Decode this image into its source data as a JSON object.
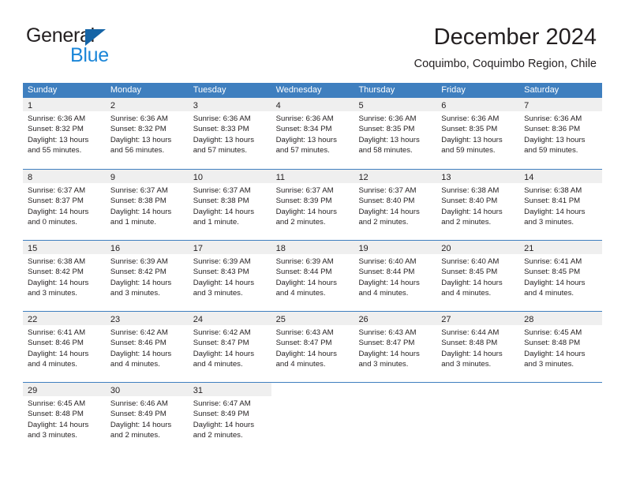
{
  "brand": {
    "word_one": "General",
    "word_two": "Blue",
    "triangle_color": "#1564a6",
    "blue_color": "#1b86d8"
  },
  "header": {
    "title": "December 2024",
    "subtitle": "Coquimbo, Coquimbo Region, Chile"
  },
  "theme": {
    "header_blue": "#3f7fbf",
    "day_band_gray": "#efefef",
    "text": "#231f20"
  },
  "weekday_headers": [
    "Sunday",
    "Monday",
    "Tuesday",
    "Wednesday",
    "Thursday",
    "Friday",
    "Saturday"
  ],
  "weeks": [
    [
      {
        "day": "1",
        "lines": [
          "Sunrise: 6:36 AM",
          "Sunset: 8:32 PM",
          "Daylight: 13 hours",
          "and 55 minutes."
        ]
      },
      {
        "day": "2",
        "lines": [
          "Sunrise: 6:36 AM",
          "Sunset: 8:32 PM",
          "Daylight: 13 hours",
          "and 56 minutes."
        ]
      },
      {
        "day": "3",
        "lines": [
          "Sunrise: 6:36 AM",
          "Sunset: 8:33 PM",
          "Daylight: 13 hours",
          "and 57 minutes."
        ]
      },
      {
        "day": "4",
        "lines": [
          "Sunrise: 6:36 AM",
          "Sunset: 8:34 PM",
          "Daylight: 13 hours",
          "and 57 minutes."
        ]
      },
      {
        "day": "5",
        "lines": [
          "Sunrise: 6:36 AM",
          "Sunset: 8:35 PM",
          "Daylight: 13 hours",
          "and 58 minutes."
        ]
      },
      {
        "day": "6",
        "lines": [
          "Sunrise: 6:36 AM",
          "Sunset: 8:35 PM",
          "Daylight: 13 hours",
          "and 59 minutes."
        ]
      },
      {
        "day": "7",
        "lines": [
          "Sunrise: 6:36 AM",
          "Sunset: 8:36 PM",
          "Daylight: 13 hours",
          "and 59 minutes."
        ]
      }
    ],
    [
      {
        "day": "8",
        "lines": [
          "Sunrise: 6:37 AM",
          "Sunset: 8:37 PM",
          "Daylight: 14 hours",
          "and 0 minutes."
        ]
      },
      {
        "day": "9",
        "lines": [
          "Sunrise: 6:37 AM",
          "Sunset: 8:38 PM",
          "Daylight: 14 hours",
          "and 1 minute."
        ]
      },
      {
        "day": "10",
        "lines": [
          "Sunrise: 6:37 AM",
          "Sunset: 8:38 PM",
          "Daylight: 14 hours",
          "and 1 minute."
        ]
      },
      {
        "day": "11",
        "lines": [
          "Sunrise: 6:37 AM",
          "Sunset: 8:39 PM",
          "Daylight: 14 hours",
          "and 2 minutes."
        ]
      },
      {
        "day": "12",
        "lines": [
          "Sunrise: 6:37 AM",
          "Sunset: 8:40 PM",
          "Daylight: 14 hours",
          "and 2 minutes."
        ]
      },
      {
        "day": "13",
        "lines": [
          "Sunrise: 6:38 AM",
          "Sunset: 8:40 PM",
          "Daylight: 14 hours",
          "and 2 minutes."
        ]
      },
      {
        "day": "14",
        "lines": [
          "Sunrise: 6:38 AM",
          "Sunset: 8:41 PM",
          "Daylight: 14 hours",
          "and 3 minutes."
        ]
      }
    ],
    [
      {
        "day": "15",
        "lines": [
          "Sunrise: 6:38 AM",
          "Sunset: 8:42 PM",
          "Daylight: 14 hours",
          "and 3 minutes."
        ]
      },
      {
        "day": "16",
        "lines": [
          "Sunrise: 6:39 AM",
          "Sunset: 8:42 PM",
          "Daylight: 14 hours",
          "and 3 minutes."
        ]
      },
      {
        "day": "17",
        "lines": [
          "Sunrise: 6:39 AM",
          "Sunset: 8:43 PM",
          "Daylight: 14 hours",
          "and 3 minutes."
        ]
      },
      {
        "day": "18",
        "lines": [
          "Sunrise: 6:39 AM",
          "Sunset: 8:44 PM",
          "Daylight: 14 hours",
          "and 4 minutes."
        ]
      },
      {
        "day": "19",
        "lines": [
          "Sunrise: 6:40 AM",
          "Sunset: 8:44 PM",
          "Daylight: 14 hours",
          "and 4 minutes."
        ]
      },
      {
        "day": "20",
        "lines": [
          "Sunrise: 6:40 AM",
          "Sunset: 8:45 PM",
          "Daylight: 14 hours",
          "and 4 minutes."
        ]
      },
      {
        "day": "21",
        "lines": [
          "Sunrise: 6:41 AM",
          "Sunset: 8:45 PM",
          "Daylight: 14 hours",
          "and 4 minutes."
        ]
      }
    ],
    [
      {
        "day": "22",
        "lines": [
          "Sunrise: 6:41 AM",
          "Sunset: 8:46 PM",
          "Daylight: 14 hours",
          "and 4 minutes."
        ]
      },
      {
        "day": "23",
        "lines": [
          "Sunrise: 6:42 AM",
          "Sunset: 8:46 PM",
          "Daylight: 14 hours",
          "and 4 minutes."
        ]
      },
      {
        "day": "24",
        "lines": [
          "Sunrise: 6:42 AM",
          "Sunset: 8:47 PM",
          "Daylight: 14 hours",
          "and 4 minutes."
        ]
      },
      {
        "day": "25",
        "lines": [
          "Sunrise: 6:43 AM",
          "Sunset: 8:47 PM",
          "Daylight: 14 hours",
          "and 4 minutes."
        ]
      },
      {
        "day": "26",
        "lines": [
          "Sunrise: 6:43 AM",
          "Sunset: 8:47 PM",
          "Daylight: 14 hours",
          "and 3 minutes."
        ]
      },
      {
        "day": "27",
        "lines": [
          "Sunrise: 6:44 AM",
          "Sunset: 8:48 PM",
          "Daylight: 14 hours",
          "and 3 minutes."
        ]
      },
      {
        "day": "28",
        "lines": [
          "Sunrise: 6:45 AM",
          "Sunset: 8:48 PM",
          "Daylight: 14 hours",
          "and 3 minutes."
        ]
      }
    ],
    [
      {
        "day": "29",
        "lines": [
          "Sunrise: 6:45 AM",
          "Sunset: 8:48 PM",
          "Daylight: 14 hours",
          "and 3 minutes."
        ]
      },
      {
        "day": "30",
        "lines": [
          "Sunrise: 6:46 AM",
          "Sunset: 8:49 PM",
          "Daylight: 14 hours",
          "and 2 minutes."
        ]
      },
      {
        "day": "31",
        "lines": [
          "Sunrise: 6:47 AM",
          "Sunset: 8:49 PM",
          "Daylight: 14 hours",
          "and 2 minutes."
        ]
      },
      {
        "day": "",
        "lines": []
      },
      {
        "day": "",
        "lines": []
      },
      {
        "day": "",
        "lines": []
      },
      {
        "day": "",
        "lines": []
      }
    ]
  ]
}
